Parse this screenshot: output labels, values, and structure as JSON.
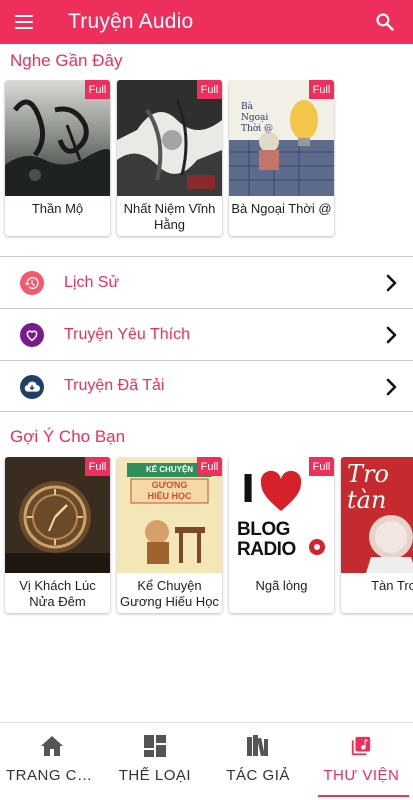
{
  "appbar": {
    "title": "Truyện Audio",
    "menu_icon": "hamburger-menu-icon",
    "search_icon": "search-icon",
    "color": "#ee2f5c"
  },
  "recent": {
    "title": "Nghe Gần Đây",
    "items": [
      {
        "title": "Thần Mộ",
        "badge": "Full"
      },
      {
        "title": "Nhất Niệm Vĩnh Hằng",
        "badge": "Full"
      },
      {
        "title": "Bà Ngoại Thời @",
        "badge": "Full"
      }
    ]
  },
  "menu": [
    {
      "label": "Lịch Sử",
      "icon": "history-icon",
      "color": "#f25b6e"
    },
    {
      "label": "Truyện Yêu Thích",
      "icon": "heart-icon",
      "color": "#7b1a8c"
    },
    {
      "label": "Truyện Đã Tải",
      "icon": "cloud-download-icon",
      "color": "#1f3f66"
    }
  ],
  "suggest": {
    "title": "Gợi Ý Cho Bạn",
    "items": [
      {
        "title": "Vị Khách Lúc Nửa Đêm",
        "badge": "Full"
      },
      {
        "title": "Kể Chuyện Gương Hiếu Học",
        "badge": "Full"
      },
      {
        "title": "Ngã lòng",
        "badge": "Full"
      },
      {
        "title": "Tàn Tro"
      }
    ]
  },
  "cover_text": {
    "ngoai": "Bà Ngoại Thời @",
    "guong1": "KỂ CHUYỆN",
    "guong2": "GƯƠNG",
    "guong3": "HIẾU HỌC",
    "blog_i": "I",
    "blog1": "BLOG",
    "blog2": "RADIO",
    "tantro": "Tro tàn"
  },
  "bottom_nav": [
    {
      "label": "TRANG CHỦ",
      "icon": "home-icon",
      "active": false
    },
    {
      "label": "THỂ LOẠI",
      "icon": "grid-icon",
      "active": false
    },
    {
      "label": "TÁC GIẢ",
      "icon": "books-icon",
      "active": false
    },
    {
      "label": "THƯ VIỆN",
      "icon": "library-music-icon",
      "active": true
    }
  ]
}
